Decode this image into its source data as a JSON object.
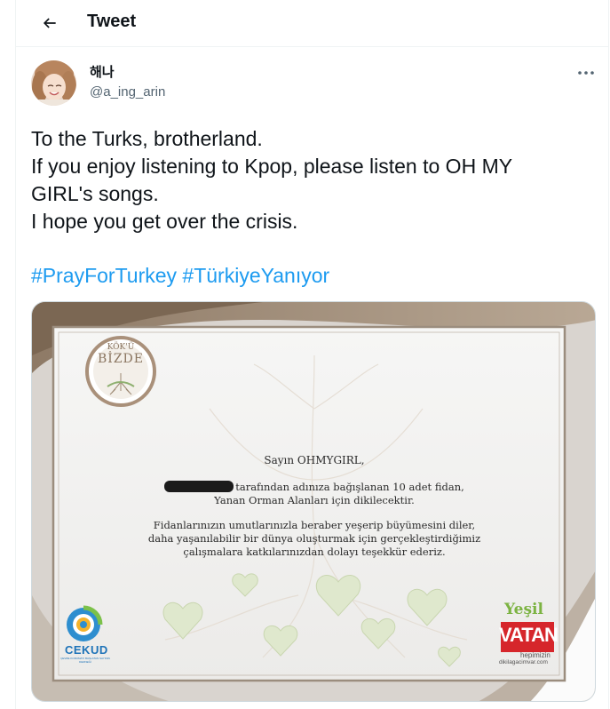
{
  "header": {
    "title": "Tweet",
    "back_icon": "arrow-left-icon"
  },
  "author": {
    "display_name": "해나",
    "handle": "@a_ing_arin",
    "more_icon": "more-dots-icon"
  },
  "tweet": {
    "lines": [
      "To the Turks, brotherland.",
      "If you enjoy listening to Kpop, please listen to OH MY",
      "GIRL's songs.",
      "I hope you get over the crisis."
    ],
    "hashtags": [
      "#PrayForTurkey",
      "#TürkiyeYanıyor"
    ]
  },
  "certificate": {
    "logo_top": "KÖK'Ü",
    "logo_bottom": "BİZDE",
    "greeting": "Sayın OHMYGIRL,",
    "line1_suffix": "tarafından adınıza bağışlanan 10 adet fidan,",
    "line2": "Yanan Orman Alanları için dikilecektir.",
    "para2_line1": "Fidanlarınızın umutlarınızla beraber yeşerip büyümesini diler,",
    "para2_line2": "daha yaşanılabilir bir dünya oluşturmak için gerçekleştirdiğimiz",
    "para2_line3": "çalışmalara katkılarınızdan dolayı teşekkür ederiz.",
    "cekud_name": "CEKUD",
    "cekud_sub": "ÇEVRE KORUMAYI BAŞLATAN SAYININ DERNEĞİ",
    "vatan_top": "Yeşil",
    "vatan_main": "VATAN",
    "vatan_sub": "hepimizin",
    "vatan_url": "dikilagacimvar.com"
  },
  "colors": {
    "link": "#1d9bf0",
    "text": "#0f1419",
    "secondary": "#536471",
    "cert_brown": "#8a7560",
    "vatan_red": "#d6262b",
    "vatan_green": "#7cb342",
    "cekud_blue": "#1e73b8"
  }
}
